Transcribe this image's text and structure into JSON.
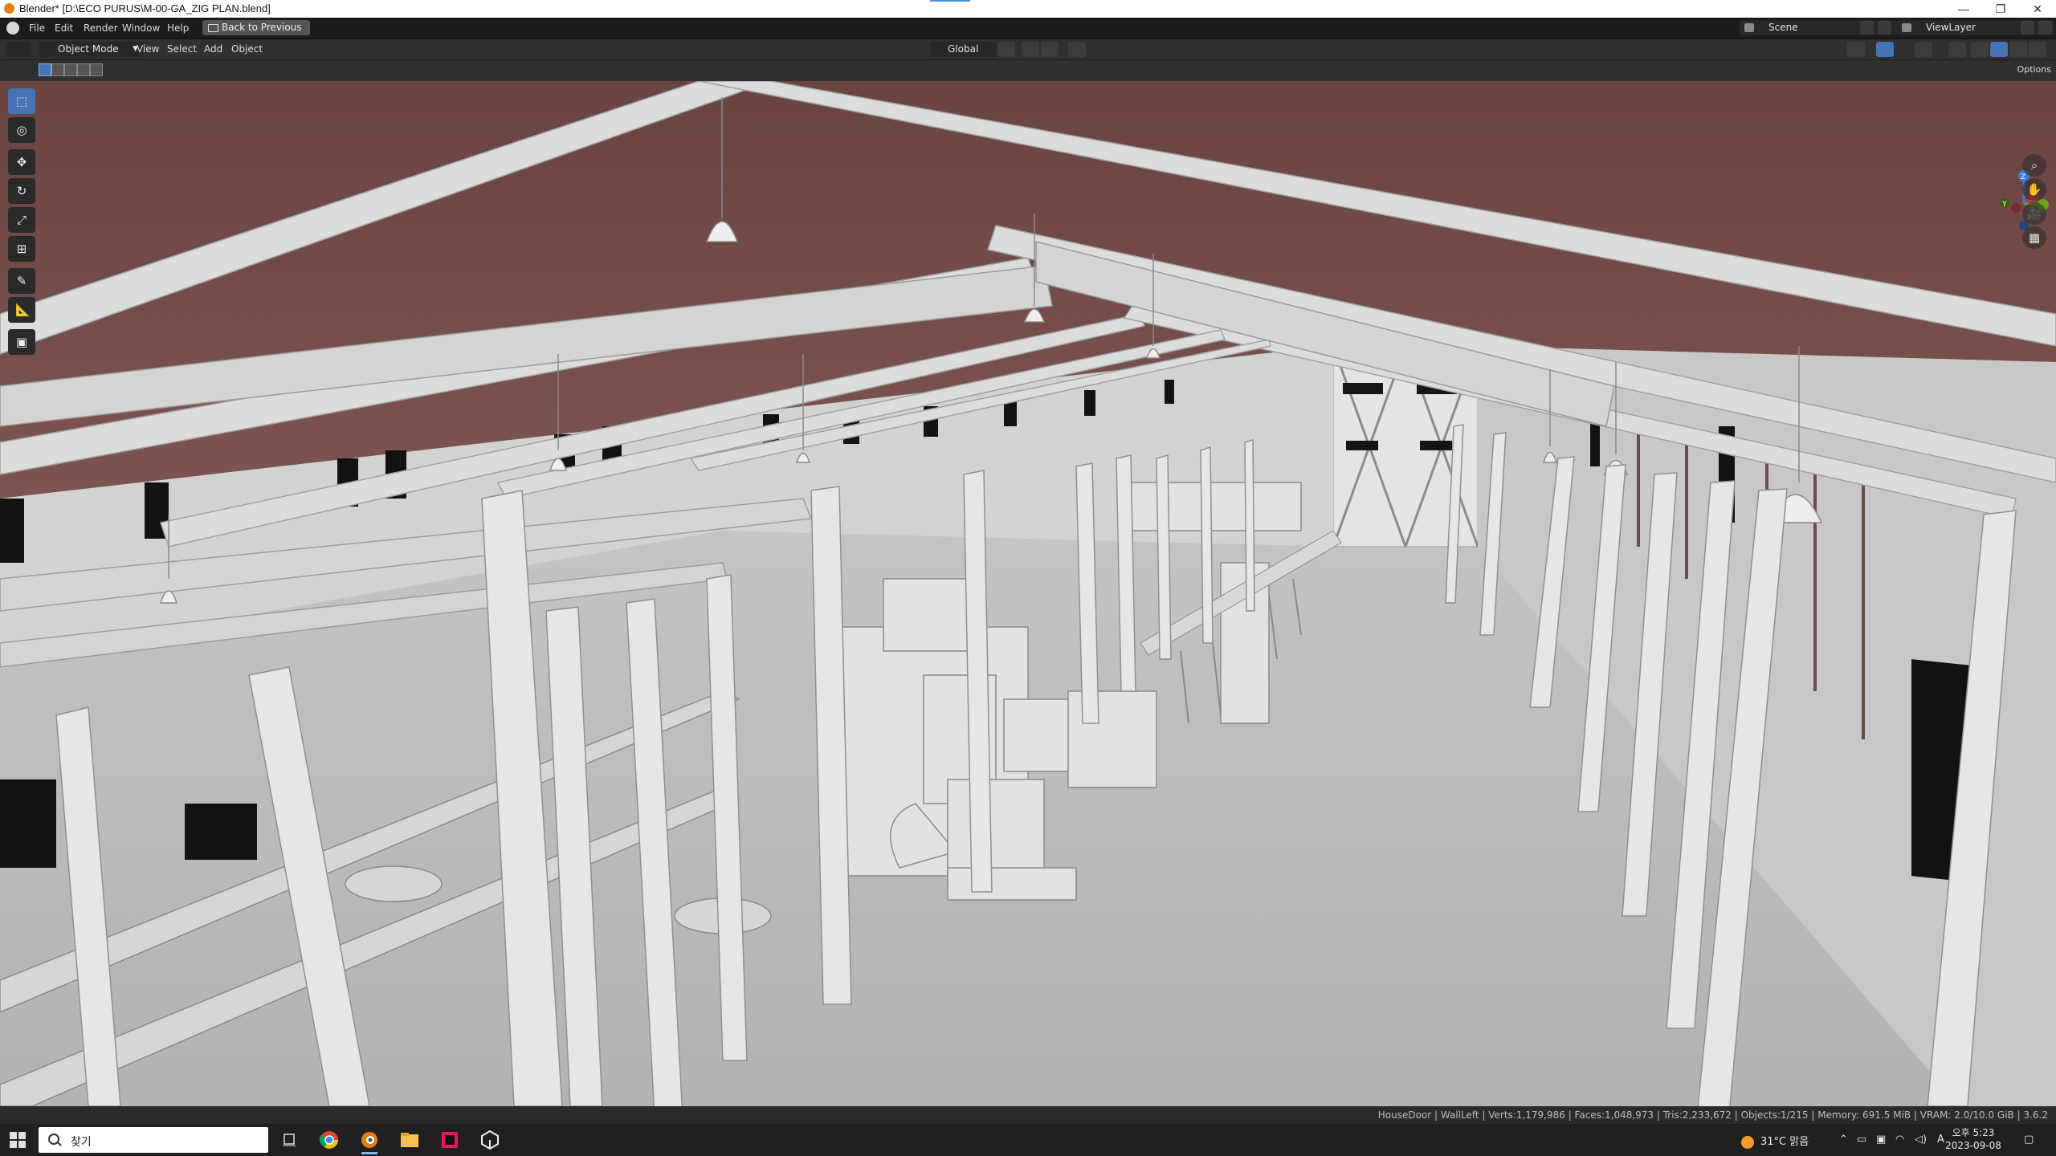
{
  "window": {
    "title": "Blender* [D:\\ECO PURUS\\M-00-GA_ZIG PLAN.blend]",
    "minimize": "—",
    "maximize": "❐",
    "close": "✕"
  },
  "menu": {
    "items": [
      "File",
      "Edit",
      "Render",
      "Window",
      "Help"
    ],
    "back_button": "Back to Previous",
    "scene": "Scene",
    "view_layer": "ViewLayer"
  },
  "header": {
    "mode": "Object Mode",
    "menus": [
      "View",
      "Select",
      "Add",
      "Object"
    ],
    "transform_orientation": "Global"
  },
  "toolrow": {
    "options": "Options"
  },
  "toolbar": {
    "tools": [
      {
        "name": "select-box-tool",
        "glyph": "⬚",
        "active": true
      },
      {
        "name": "cursor-tool",
        "glyph": "◎",
        "active": false
      },
      {
        "name": "move-tool",
        "glyph": "✥",
        "active": false
      },
      {
        "name": "rotate-tool",
        "glyph": "↻",
        "active": false
      },
      {
        "name": "scale-tool",
        "glyph": "⤢",
        "active": false
      },
      {
        "name": "transform-tool",
        "glyph": "⊞",
        "active": false
      },
      {
        "name": "annotate-tool",
        "glyph": "✎",
        "active": false
      },
      {
        "name": "measure-tool",
        "glyph": "📐",
        "active": false
      },
      {
        "name": "add-cube-tool",
        "glyph": "▣",
        "active": false
      }
    ]
  },
  "gizmo": {
    "z": "Z",
    "y": "Y",
    "colors": {
      "x": "#c83a4a",
      "y": "#6ea31e",
      "z": "#3f7bd6",
      "neg": "#7a2532"
    }
  },
  "nav": {
    "zoom": "⌕",
    "pan": "✋",
    "camera": "🎥",
    "ortho": "▦"
  },
  "status": {
    "text": "HouseDoor | WallLeft | Verts:1,179,986 | Faces:1,048,973 | Tris:2,233,672 | Objects:1/215 | Memory: 691.5 MiB | VRAM: 2.0/10.0 GiB | 3.6.2"
  },
  "taskbar": {
    "search_placeholder": "찾기",
    "weather": "31°C  맑음",
    "time": "오후 5:23",
    "date": "2023-09-08",
    "ime": "A",
    "apps": [
      "task-view",
      "chrome",
      "blender",
      "file-explorer",
      "jetbrains",
      "unity"
    ]
  },
  "colors": {
    "accent": "#4772b3",
    "ceiling": "#6f4a48",
    "beam": "#d9d9d9",
    "floor": "#bfbfbf"
  }
}
